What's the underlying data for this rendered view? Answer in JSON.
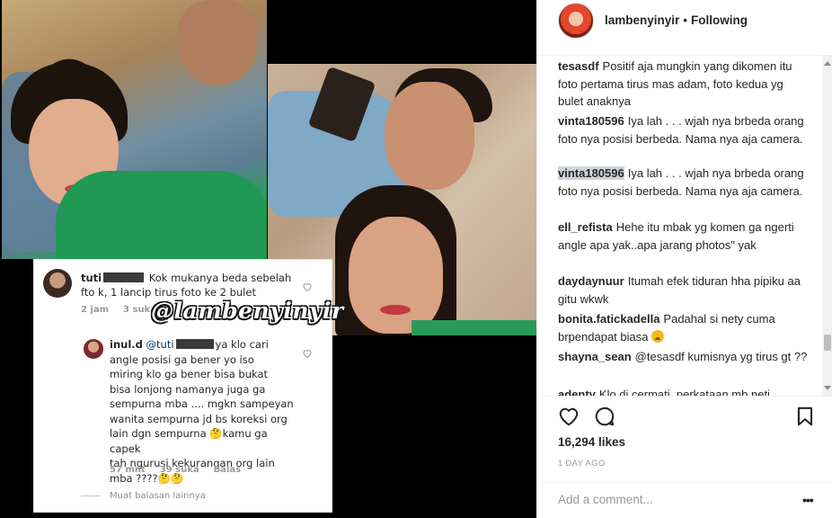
{
  "post": {
    "username": "lambenyinyir",
    "separator": "•",
    "follow_status": "Following",
    "likes": "16,294 likes",
    "time_ago": "1 DAY AGO",
    "add_comment_placeholder": "Add a comment...",
    "more_options": "•••"
  },
  "comments": [
    {
      "user": "tesasdf",
      "text": "Positif aja mungkin yang dikomen itu foto pertama tirus mas adam, foto kedua yg bulet anaknya"
    },
    {
      "user": "vinta180596",
      "text": "Iya lah . . . wjah nya brbeda orang foto nya posisi berbeda. Nama nya aja camera."
    },
    {
      "user": "vinta180596",
      "text": "Iya lah . . . wjah nya brbeda orang foto nya posisi berbeda. Nama nya aja camera.",
      "highlighted": true
    },
    {
      "user": "ell_refista",
      "text": "Hehe itu mbak yg komen ga ngerti angle apa yak..apa jarang photos\" yak"
    },
    {
      "user": "daydaynuur",
      "text": "Itumah efek tiduran hha pipiku aa gitu wkwk"
    },
    {
      "user": "bonita.fatickadella",
      "text": "Padahal si nety cuma brpendapat biasa",
      "emoji": "worried-face-emoji"
    },
    {
      "user": "shayna_sean",
      "text": "@tesasdf kumisnya yg tirus gt ??"
    },
    {
      "user": "adenty",
      "text": "Klo di cermati, perkataan mb neti"
    }
  ],
  "image_overlay": {
    "watermark": "@lambenyinyir",
    "comment1": {
      "user": "tuti",
      "text_a": "Kok mukanya beda sebelah",
      "text_b": "fto k, 1 lancip tirus foto ke 2 bulet",
      "time": "2 jam",
      "likes": "3 suka"
    },
    "comment2": {
      "user": "inul.d",
      "mention": "@tuti",
      "text_a": "ya klo cari",
      "lines": [
        "angle posisi ga bener yo iso",
        "miring klo ga bener bisa bukat",
        "bisa lonjong namanya juga ga",
        "sempurna mba .... mgkn sampeyan",
        "wanita sempurna jd bs koreksi org",
        "lain dgn sempurna 🤔kamu ga capek",
        "tah ngurusi kekurangan org lain",
        "mba ????🤔🤔"
      ],
      "time": "57 mnt",
      "likes": "39 suka",
      "reply": "Balas"
    },
    "view_replies": "Muat balasan lainnya"
  },
  "colors": {
    "text": "#262626",
    "muted": "#999999",
    "border": "#efefef",
    "like_red": "#ed4956"
  },
  "icons": [
    "heart-icon",
    "comment-icon",
    "bookmark-icon",
    "heart-outline-icon"
  ]
}
